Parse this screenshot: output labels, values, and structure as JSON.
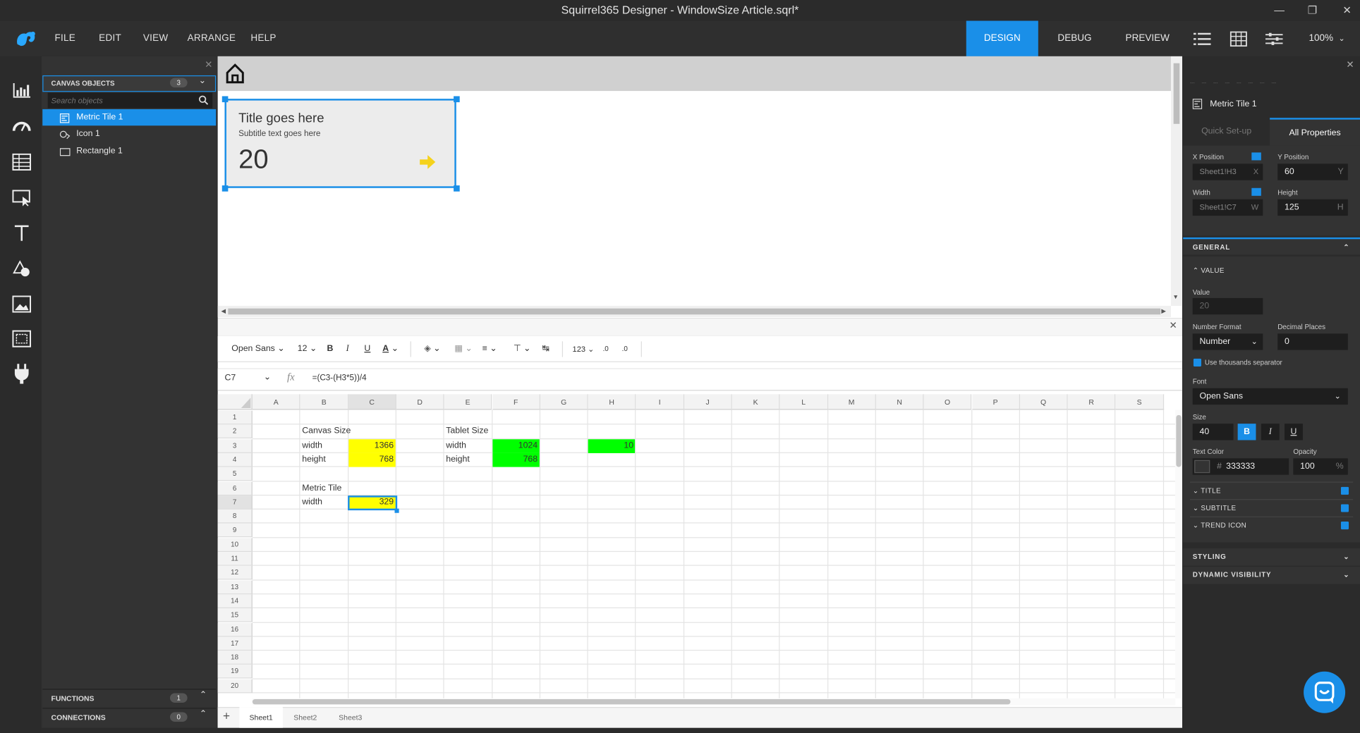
{
  "window": {
    "title": "Squirrel365 Designer - WindowSize Article.sqrl*"
  },
  "menu": [
    "FILE",
    "EDIT",
    "VIEW",
    "ARRANGE",
    "HELP"
  ],
  "modes": {
    "design": "DESIGN",
    "debug": "DEBUG",
    "preview": "PREVIEW",
    "active": "DESIGN"
  },
  "zoom": "100%",
  "rail_icons": [
    "chart-icon",
    "gauge-icon",
    "table-icon",
    "selection-icon",
    "text-icon",
    "shapes-icon",
    "image-icon",
    "container-icon",
    "plugin-icon"
  ],
  "objects_panel": {
    "header": "CANVAS OBJECTS",
    "count": "3",
    "search_placeholder": "Search objects",
    "items": [
      {
        "label": "Metric Tile 1",
        "icon": "metric-tile-icon",
        "selected": true
      },
      {
        "label": "Icon 1",
        "icon": "icon-object-icon",
        "selected": false
      },
      {
        "label": "Rectangle 1",
        "icon": "rectangle-icon",
        "selected": false
      }
    ],
    "functions": {
      "label": "FUNCTIONS",
      "count": "1"
    },
    "connections": {
      "label": "CONNECTIONS",
      "count": "0"
    }
  },
  "tile": {
    "title": "Title goes here",
    "subtitle": "Subtitle text goes here",
    "value": "20"
  },
  "format_bar": {
    "font": "Open Sans",
    "size": "12",
    "bold": "B",
    "italic": "I",
    "underline": "U",
    "number": "123"
  },
  "formula": {
    "cell_ref": "C7",
    "fx": "fx",
    "formula": "=(C3-(H3*5))/4"
  },
  "sheet": {
    "columns": [
      "A",
      "B",
      "C",
      "D",
      "E",
      "F",
      "G",
      "H",
      "I",
      "J",
      "K",
      "L",
      "M",
      "N",
      "O",
      "P",
      "Q",
      "R",
      "S"
    ],
    "rows": [
      "1",
      "2",
      "3",
      "4",
      "5",
      "6",
      "7",
      "8",
      "9",
      "10",
      "11",
      "12",
      "13",
      "14",
      "15",
      "16",
      "17",
      "18",
      "19",
      "20"
    ],
    "cells": {
      "B2": "Canvas Size",
      "B3": "width",
      "C3": "1366",
      "B4": "height",
      "C4": "768",
      "E2": "Tablet Size",
      "E3": "width",
      "F3": "1024",
      "E4": "height",
      "F4": "768",
      "H3": "10",
      "B6": "Metric Tile",
      "B7": "width",
      "C7": "329"
    },
    "tabs": [
      "Sheet1",
      "Sheet2",
      "Sheet3"
    ],
    "active_tab": "Sheet1",
    "highlight_colors": {
      "yellow": "#ffff00",
      "green": "#00ff00"
    }
  },
  "properties": {
    "object_name": "Metric Tile 1",
    "tabs": {
      "quick": "Quick Set-up",
      "all": "All Properties"
    },
    "x_label": "X Position",
    "x_value": "Sheet1!H3",
    "x_unit": "X",
    "y_label": "Y Position",
    "y_value": "60",
    "y_unit": "Y",
    "w_label": "Width",
    "w_value": "Sheet1!C7",
    "w_unit": "W",
    "h_label": "Height",
    "h_value": "125",
    "h_unit": "H",
    "general": "GENERAL",
    "value_section": "VALUE",
    "value_label": "Value",
    "value_value": "20",
    "number_format_label": "Number Format",
    "number_format_value": "Number",
    "decimal_label": "Decimal Places",
    "decimal_value": "0",
    "thousands": "Use thousands separator",
    "font_label": "Font",
    "font_value": "Open Sans",
    "size_label": "Size",
    "size_value": "40",
    "text_color_label": "Text Color",
    "text_color_hash": "#",
    "text_color_value": "333333",
    "opacity_label": "Opacity",
    "opacity_value": "100",
    "opacity_unit": "%",
    "title_sec": "TITLE",
    "subtitle_sec": "SUBTITLE",
    "trend_sec": "TREND ICON",
    "styling": "STYLING",
    "dynamic": "DYNAMIC VISIBILITY"
  },
  "accent_color": "#1a8fe8"
}
